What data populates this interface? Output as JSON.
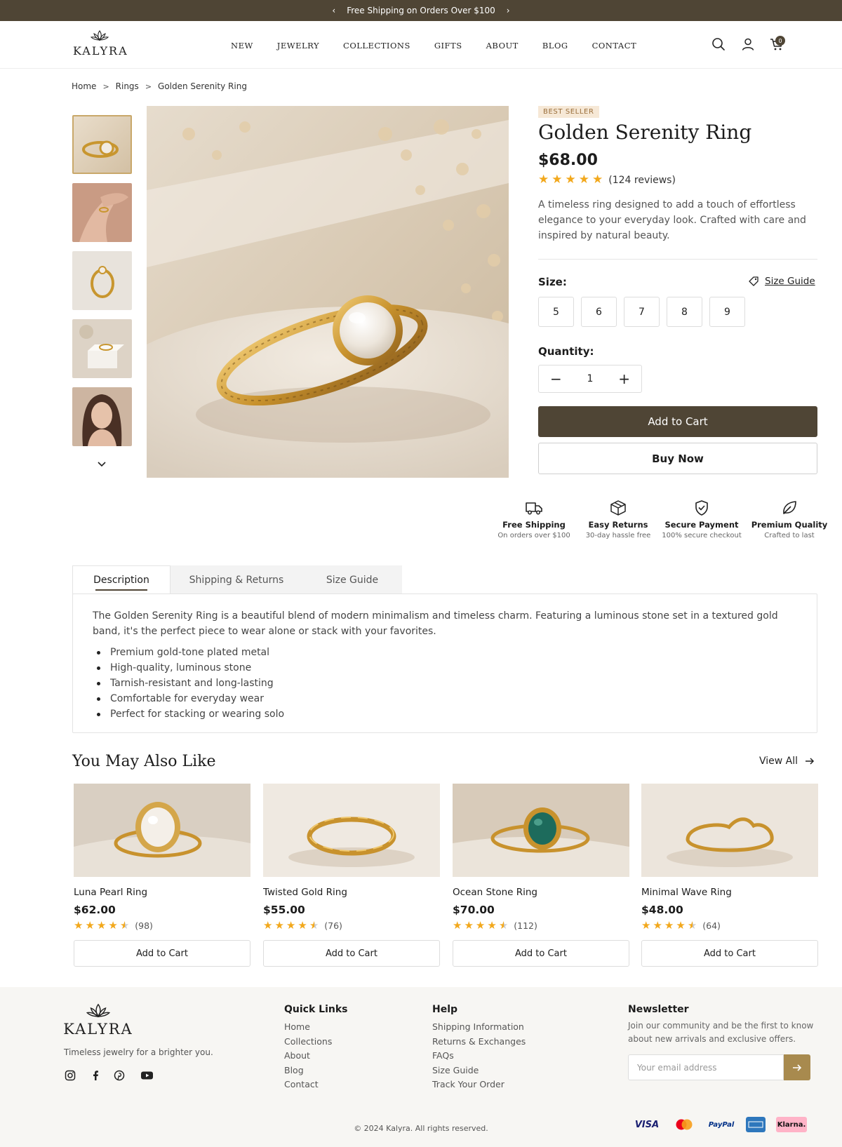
{
  "announcement": {
    "text": "Free Shipping on Orders Over $100"
  },
  "brand": {
    "name": "KALYRA",
    "tagline": "Timeless jewelry for a brighter you."
  },
  "nav": [
    "NEW",
    "JEWELRY",
    "COLLECTIONS",
    "GIFTS",
    "ABOUT",
    "BLOG",
    "CONTACT"
  ],
  "cart": {
    "count": "0"
  },
  "breadcrumb": {
    "home": "Home",
    "rings": "Rings",
    "current": "Golden Serenity Ring"
  },
  "product": {
    "badge": "BEST SELLER",
    "title": "Golden Serenity Ring",
    "price": "$68.00",
    "rating_value": 5,
    "reviews": "(124 reviews)",
    "description": "A timeless ring designed to add a touch of effortless elegance to your everyday look. Crafted with care and inspired by natural beauty.",
    "size_label": "Size:",
    "size_guide_label": "Size Guide",
    "sizes": [
      "5",
      "6",
      "7",
      "8",
      "9"
    ],
    "quantity_label": "Quantity:",
    "quantity": "1",
    "add_to_cart": "Add to Cart",
    "buy_now": "Buy Now"
  },
  "features": [
    {
      "title": "Free Shipping",
      "sub": "On orders over $100",
      "icon": "truck-icon"
    },
    {
      "title": "Easy Returns",
      "sub": "30-day hassle free",
      "icon": "box-icon"
    },
    {
      "title": "Secure Payment",
      "sub": "100% secure checkout",
      "icon": "shield-icon"
    },
    {
      "title": "Premium Quality",
      "sub": "Crafted to last",
      "icon": "leaf-icon"
    }
  ],
  "tabs": {
    "description": "Description",
    "shipping": "Shipping & Returns",
    "size_guide": "Size Guide",
    "body": "The Golden Serenity Ring is a beautiful blend of modern minimalism and timeless charm. Featuring a luminous stone set in a textured gold band, it's the perfect piece to wear alone or stack with your favorites.",
    "bullets": [
      "Premium gold-tone plated metal",
      "High-quality, luminous stone",
      "Tarnish-resistant and long-lasting",
      "Comfortable for everyday wear",
      "Perfect for stacking or wearing solo"
    ]
  },
  "related": {
    "title": "You May Also Like",
    "view_all": "View All",
    "items": [
      {
        "name": "Luna Pearl Ring",
        "price": "$62.00",
        "rating": 4.5,
        "reviews": "(98)",
        "button": "Add to Cart"
      },
      {
        "name": "Twisted Gold Ring",
        "price": "$55.00",
        "rating": 4.5,
        "reviews": "(76)",
        "button": "Add to Cart"
      },
      {
        "name": "Ocean Stone Ring",
        "price": "$70.00",
        "rating": 4.5,
        "reviews": "(112)",
        "button": "Add to Cart"
      },
      {
        "name": "Minimal Wave Ring",
        "price": "$48.00",
        "rating": 4.5,
        "reviews": "(64)",
        "button": "Add to Cart"
      }
    ]
  },
  "footer": {
    "quick_links_title": "Quick Links",
    "quick_links": [
      "Home",
      "Collections",
      "About",
      "Blog",
      "Contact"
    ],
    "help_title": "Help",
    "help_links": [
      "Shipping Information",
      "Returns & Exchanges",
      "FAQs",
      "Size Guide",
      "Track Your Order"
    ],
    "newsletter_title": "Newsletter",
    "newsletter_text": "Join our community and be the first to know about new arrivals and exclusive offers.",
    "email_placeholder": "Your email address",
    "copyright": "© 2024 Kalyra. All rights reserved.",
    "payments": [
      "VISA",
      "PayPal",
      "Klarna."
    ]
  },
  "colors": {
    "accent": "#4f4535",
    "gold": "#c9a86a",
    "star": "#f2a81c",
    "badge_bg": "#f6e8d6"
  }
}
